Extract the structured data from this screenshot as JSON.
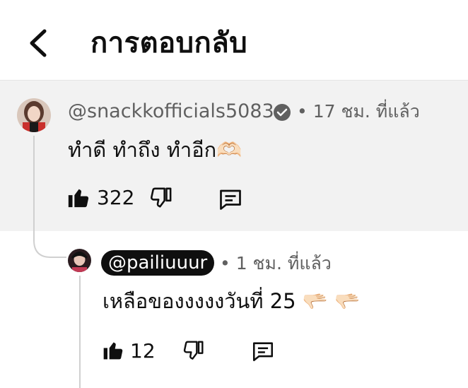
{
  "header": {
    "title": "การตอบกลับ"
  },
  "comment": {
    "handle": "@snackkofficials5083",
    "time": "• 17 ชม. ที่แล้ว",
    "text": "ทำดี ทำถึง ทำอีก",
    "emoji": "🫶🏻",
    "likes": "322"
  },
  "reply": {
    "handle": "@pailiuuur",
    "time": "• 1 ชม. ที่แล้ว",
    "text": "เหลือของงงงงวันที่ 25",
    "emoji": "🫳🏻 🫳🏻",
    "likes": "12"
  },
  "icons": {
    "back": "chevron-left-icon",
    "verified": "verified-badge-icon",
    "like": "thumbs-up-icon",
    "dislike": "thumbs-down-icon",
    "reply": "comment-icon"
  }
}
